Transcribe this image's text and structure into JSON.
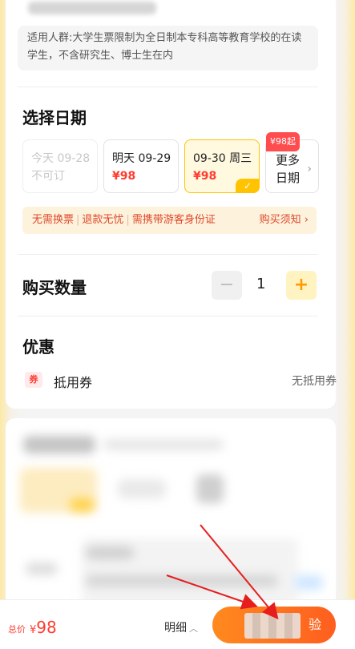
{
  "notice": {
    "text": "适用人群:大学生票限制为全日制本专科高等教育学校的在读学生，不含研究生、博士生在内"
  },
  "date_section": {
    "title": "选择日期",
    "dates": [
      {
        "day": "今天 09-28",
        "status": "不可订",
        "disabled": true
      },
      {
        "day": "明天 09-29",
        "price": "¥98"
      },
      {
        "day": "09-30 周三",
        "price": "¥98",
        "selected": true
      }
    ],
    "more": {
      "badge": "¥98起",
      "line1": "更多",
      "line2": "日期"
    }
  },
  "policy": {
    "items": [
      "无需换票",
      "退款无忧",
      "需携带游客身份证"
    ],
    "separator": "|",
    "link": "购买须知"
  },
  "quantity": {
    "title": "购买数量",
    "minus": "−",
    "plus": "+",
    "value": "1"
  },
  "discount": {
    "title": "优惠",
    "coupon_icon_text": "券",
    "coupon_label": "抵用券",
    "coupon_value": "无抵用券"
  },
  "bottom_bar": {
    "total_label": "总价",
    "currency": "¥",
    "total_value": "98",
    "detail_label": "明细",
    "buy_label": "验"
  },
  "colors": {
    "accent": "#ffc300",
    "price": "#ff3b30",
    "buy_button": "#ff6a1f"
  }
}
